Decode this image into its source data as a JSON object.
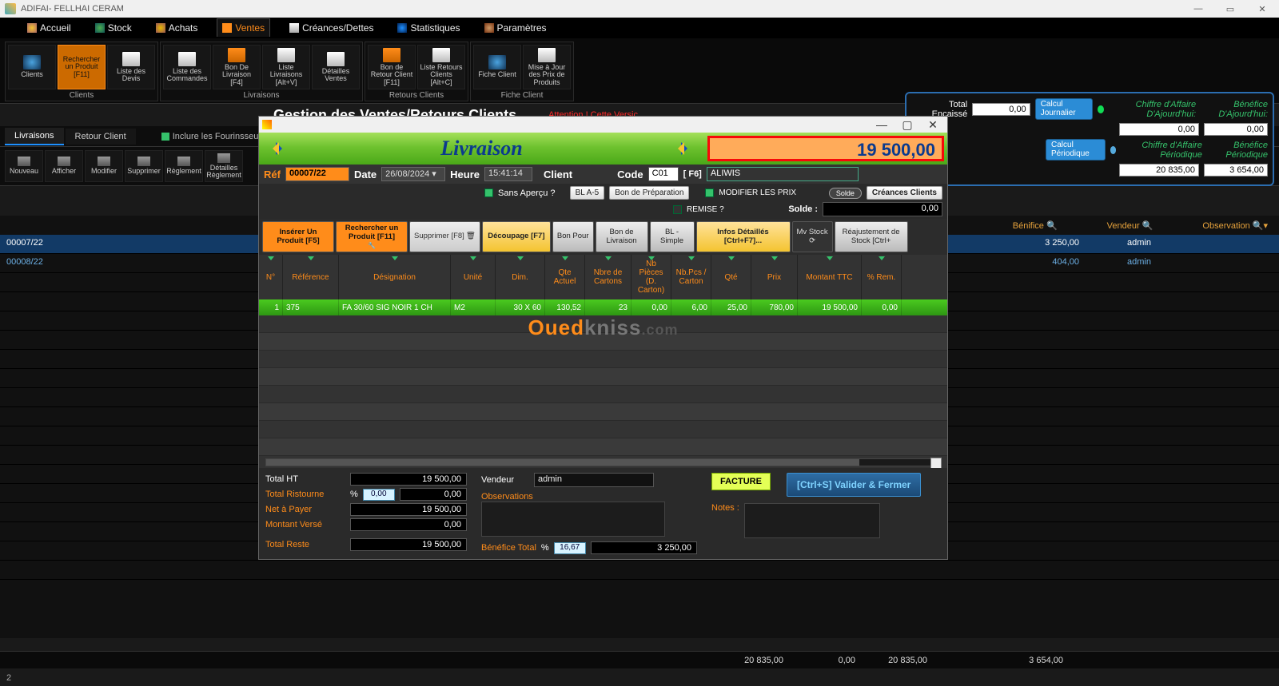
{
  "app_title": "ADIFAI- FELLHAI CERAM",
  "nav": {
    "accueil": "Accueil",
    "stock": "Stock",
    "achats": "Achats",
    "ventes": "Ventes",
    "creances": "Créances/Dettes",
    "stats": "Statistiques",
    "params": "Paramètres"
  },
  "ribbon": {
    "clients_grp": "Clients",
    "livraisons_grp": "Livraisons",
    "retours_grp": "Retours Clients",
    "fiche_grp": "Fiche Client",
    "clients": "Clients",
    "rechercher_produit": "Rechercher un Produit [F11]",
    "liste_devis": "Liste des Devis",
    "liste_commandes": "Liste des Commandes",
    "bon_livraison": "Bon De Livraison [F4]",
    "liste_livraisons": "Liste Livraisons [Alt+V]",
    "detail_ventes": "Détailles Ventes",
    "bon_retour": "Bon de Retour Client [F11]",
    "liste_retours": "Liste Retours Clients [Alt+C]",
    "fiche_client": "Fiche Client",
    "mise_jour": "Mise à Jour des Prix de Produits"
  },
  "subheader_title": "Gestion des Ventes/Retours Clients",
  "warning": "Attention ! Cette Versic",
  "right_panel": {
    "total_encaisse_label": "Total Encaissé",
    "total_encaisse": "0,00",
    "calc_journ": "Calcul Journalier",
    "calc_per": "Calcul Périodique",
    "ca_aujourd": "Chiffre d'Affaire D'Ajourd'hui:",
    "bene_aujourd": "Bénéfice D'Ajourd'hui:",
    "ca_aujourd_v": "0,00",
    "bene_aujourd_v": "0,00",
    "ca_per": "Chiffre d'Affaire Périodique",
    "bene_per": "Bénéfice Périodique",
    "ca_per_v": "20 835,00",
    "bene_per_v": "3 654,00"
  },
  "tabs": {
    "livraisons": "Livraisons",
    "retour": "Retour Client",
    "inclure": "Inclure les Fourinsseurs ?"
  },
  "smallbar": {
    "nouveau": "Nouveau",
    "afficher": "Afficher",
    "modifier": "Modifier",
    "supprimer": "Supprimer",
    "reglement": "Règlement",
    "detail_regl": "Détailles Règlement"
  },
  "bgcols": {
    "benefice": "Bénifice",
    "vendeur": "Vendeur",
    "observation": "Observation"
  },
  "bglist": [
    {
      "ref": "00007/22",
      "benefice": "3 250,00",
      "vendeur": "admin"
    },
    {
      "ref": "00008/22",
      "benefice": "404,00",
      "vendeur": "admin"
    }
  ],
  "bgfoot": {
    "c1": "20 835,00",
    "c2": "0,00",
    "c3": "20 835,00",
    "c4": "3 654,00"
  },
  "page_number": "2",
  "modal": {
    "title": "Livraison",
    "total_big": "19 500,00",
    "ref_l": "Réf",
    "ref": "00007/22",
    "date_l": "Date",
    "date": "26/08/2024",
    "heure_l": "Heure",
    "heure": "15:41:14",
    "client_l": "Client",
    "code_l": "Code",
    "code": "C01",
    "f6": "[ F6]",
    "client_name": "ALIWIS",
    "sans_apercu": "Sans Aperçu ?",
    "bla5": "BL A-5",
    "bon_prep": "Bon de Préparation",
    "modif_prix": "MODIFIER LES PRIX",
    "remise": "REMISE ?",
    "solde_chip": "Solde",
    "cre_clients": "Créances Clients",
    "solde_l": "Solde :",
    "solde_v": "0,00",
    "actions": {
      "inserer": "Insérer Un Produit [F5]",
      "rechercher": "Rechercher un Produit [F11]",
      "supprimer": "Supprimer [F8]",
      "decoupage": "Découpage [F7]",
      "bon_pour": "Bon Pour",
      "bon_liv": "Bon de Livraison",
      "bl_simple": "BL -Simple",
      "infos": "Infos Détaillés [Ctrl+F7]...",
      "mv_stock": "Mv Stock",
      "reajust": "Réajustement de Stock [Ctrl+"
    },
    "gridcols": {
      "n": "N°",
      "ref": "Référence",
      "des": "Désignation",
      "unit": "Unité",
      "dim": "Dim.",
      "qa": "Qte Actuel",
      "nc": "Nbre de Cartons",
      "np": "Nb Pièces (D. Carton)",
      "npc": "Nb.Pcs / Carton",
      "qte": "Qté",
      "prix": "Prix",
      "mtc": "Montant TTC",
      "rem": "% Rem."
    },
    "row": {
      "n": "1",
      "ref": "375",
      "des": "FA 30/60 SIG NOIR 1 CH",
      "unit": "M2",
      "dim": "30 X 60",
      "qa": "130,52",
      "nc": "23",
      "np": "0,00",
      "npc": "6,00",
      "qte": "25,00",
      "prix": "780,00",
      "mtc": "19 500,00",
      "rem": "0,00"
    },
    "foot": {
      "total_ht_l": "Total HT",
      "total_ht": "19 500,00",
      "ristourne_l": "Total Ristourne",
      "ristourne_pct": "0,00",
      "ristourne": "0,00",
      "pct": "%",
      "net_l": "Net à Payer",
      "net": "19 500,00",
      "verse_l": "Montant Versé",
      "verse": "0,00",
      "reste_l": "Total Reste",
      "reste": "19 500,00",
      "vendeur_l": "Vendeur",
      "vendeur": "admin",
      "obs_l": "Observations",
      "notes_l": "Notes :",
      "benef_l": "Bénéfice Total",
      "benef_pct": "16,67",
      "benef": "3 250,00",
      "facture": "FACTURE",
      "valider": "[Ctrl+S] Valider & Fermer"
    }
  }
}
